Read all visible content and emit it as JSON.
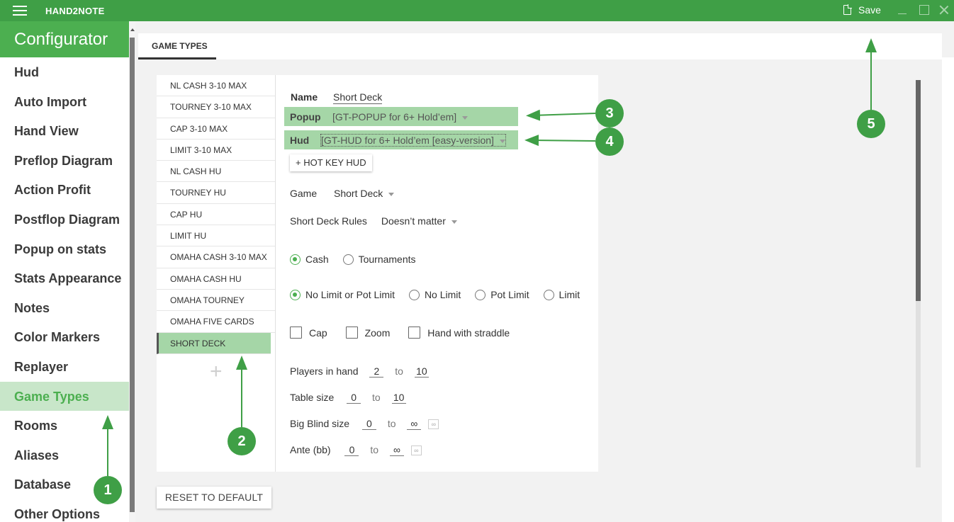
{
  "app": {
    "title": "HAND2NOTE",
    "save_label": "Save"
  },
  "sidebar": {
    "title": "Configurator",
    "items": [
      {
        "label": "Hud"
      },
      {
        "label": "Auto Import"
      },
      {
        "label": "Hand View"
      },
      {
        "label": "Preflop Diagram"
      },
      {
        "label": "Action Profit"
      },
      {
        "label": "Postflop Diagram"
      },
      {
        "label": "Popup on stats"
      },
      {
        "label": "Stats Appearance"
      },
      {
        "label": "Notes"
      },
      {
        "label": "Color Markers"
      },
      {
        "label": "Replayer"
      },
      {
        "label": "Game Types",
        "active": true
      },
      {
        "label": "Rooms"
      },
      {
        "label": "Aliases"
      },
      {
        "label": "Database"
      },
      {
        "label": "Other Options"
      }
    ]
  },
  "tabs": [
    {
      "label": "GAME TYPES"
    }
  ],
  "game_types": [
    "NL CASH 3-10 MAX",
    "TOURNEY 3-10 MAX",
    "CAP 3-10 MAX",
    "LIMIT 3-10 MAX",
    "NL CASH HU",
    "TOURNEY HU",
    "CAP HU",
    "LIMIT HU",
    "OMAHA CASH 3-10 MAX",
    "OMAHA CASH HU",
    "OMAHA TOURNEY",
    "OMAHA FIVE CARDS",
    "SHORT DECK"
  ],
  "add_symbol": "+",
  "form": {
    "name_label": "Name",
    "name_value": "Short Deck",
    "popup_label": "Popup",
    "popup_value": "[GT-POPUP for 6+ Hold’em]",
    "hud_label": "Hud",
    "hud_value": "[GT-HUD for 6+ Hold’em [easy-version]",
    "hotkey_label": "+ HOT KEY HUD",
    "game_label": "Game",
    "game_value": "Short Deck",
    "sd_rules_label": "Short Deck Rules",
    "sd_rules_value": "Doesn’t matter",
    "type_options": [
      "Cash",
      "Tournaments"
    ],
    "limit_options": [
      "No Limit or Pot Limit",
      "No Limit",
      "Pot Limit",
      "Limit"
    ],
    "checkboxes": [
      "Cap",
      "Zoom",
      "Hand with straddle"
    ],
    "to_label": "to",
    "players_label": "Players in hand",
    "players_min": "2",
    "players_max": "10",
    "table_label": "Table size",
    "table_min": "0",
    "table_max": "10",
    "bb_label": "Big Blind size",
    "bb_min": "0",
    "bb_max": "∞",
    "ante_label": "Ante (bb)",
    "ante_min": "0",
    "ante_max": "∞",
    "inf_symbol": "∞"
  },
  "reset_label": "RESET TO DEFAULT",
  "callouts": [
    "1",
    "2",
    "3",
    "4",
    "5"
  ],
  "colors": {
    "brand_green": "#3f9f46",
    "active_green": "#a5d6a7"
  }
}
